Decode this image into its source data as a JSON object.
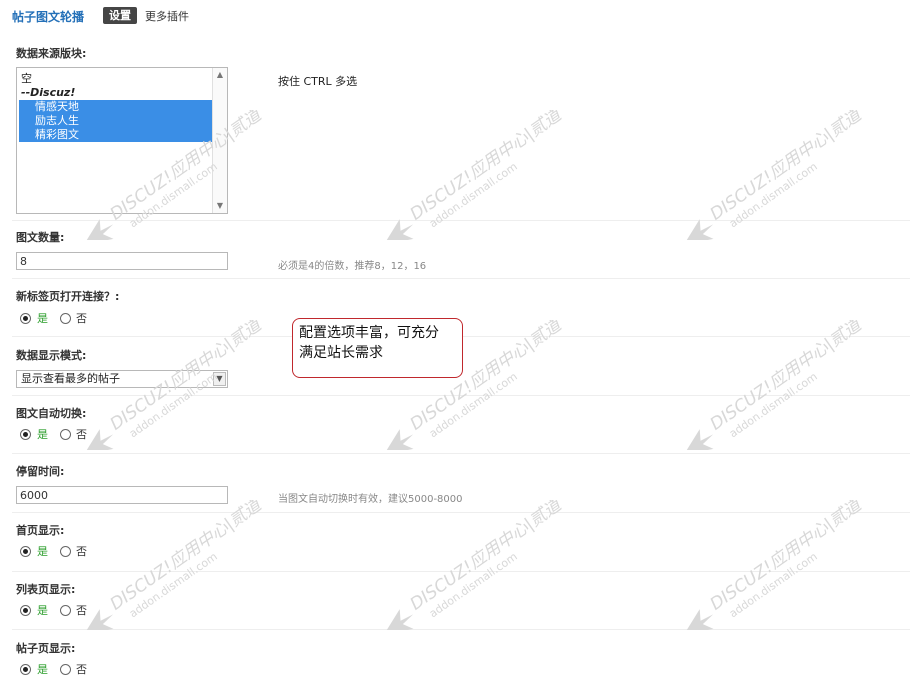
{
  "header": {
    "title": "帖子图文轮播",
    "active_tab": "设置",
    "more_link": "更多插件"
  },
  "source_block": {
    "label": "数据来源版块:",
    "options": [
      {
        "text": "空",
        "type": "plain",
        "selected": false
      },
      {
        "text": "--Discuz!",
        "type": "group",
        "selected": false
      },
      {
        "text": "情感天地",
        "type": "item",
        "selected": true
      },
      {
        "text": "励志人生",
        "type": "item",
        "selected": true
      },
      {
        "text": "精彩图文",
        "type": "item",
        "selected": true
      }
    ],
    "tip": "按住 CTRL 多选"
  },
  "image_count": {
    "label": "图文数量:",
    "value": "8",
    "tip": "必须是4的倍数，推荐8，12，16"
  },
  "new_tab": {
    "label": "新标签页打开连接？:",
    "yes": "是",
    "no": "否",
    "selected": "yes"
  },
  "display_mode": {
    "label": "数据显示模式:",
    "value": "显示查看最多的帖子"
  },
  "auto_switch": {
    "label": "图文自动切换:",
    "yes": "是",
    "no": "否",
    "selected": "yes"
  },
  "dwell_time": {
    "label": "停留时间:",
    "value": "6000",
    "tip": "当图文自动切换时有效，建议5000-8000"
  },
  "home_show": {
    "label": "首页显示:",
    "yes": "是",
    "no": "否",
    "selected": "yes"
  },
  "list_show": {
    "label": "列表页显示:",
    "yes": "是",
    "no": "否",
    "selected": "yes"
  },
  "thread_show": {
    "label": "帖子页显示:",
    "yes": "是",
    "no": "否",
    "selected": "yes"
  },
  "callout": {
    "line1": "配置选项丰富，可充分",
    "line2": "满足站长需求"
  },
  "watermark": {
    "line1": "DISCUZ!应用中心|贰道",
    "line2": "addon.dismall.com",
    "color": "#d8d8d8"
  },
  "colors": {
    "title": "#2470b8",
    "selected_option": "#3a8ee6",
    "yes_label": "#2a9d2a",
    "callout_border": "#c0282d"
  }
}
